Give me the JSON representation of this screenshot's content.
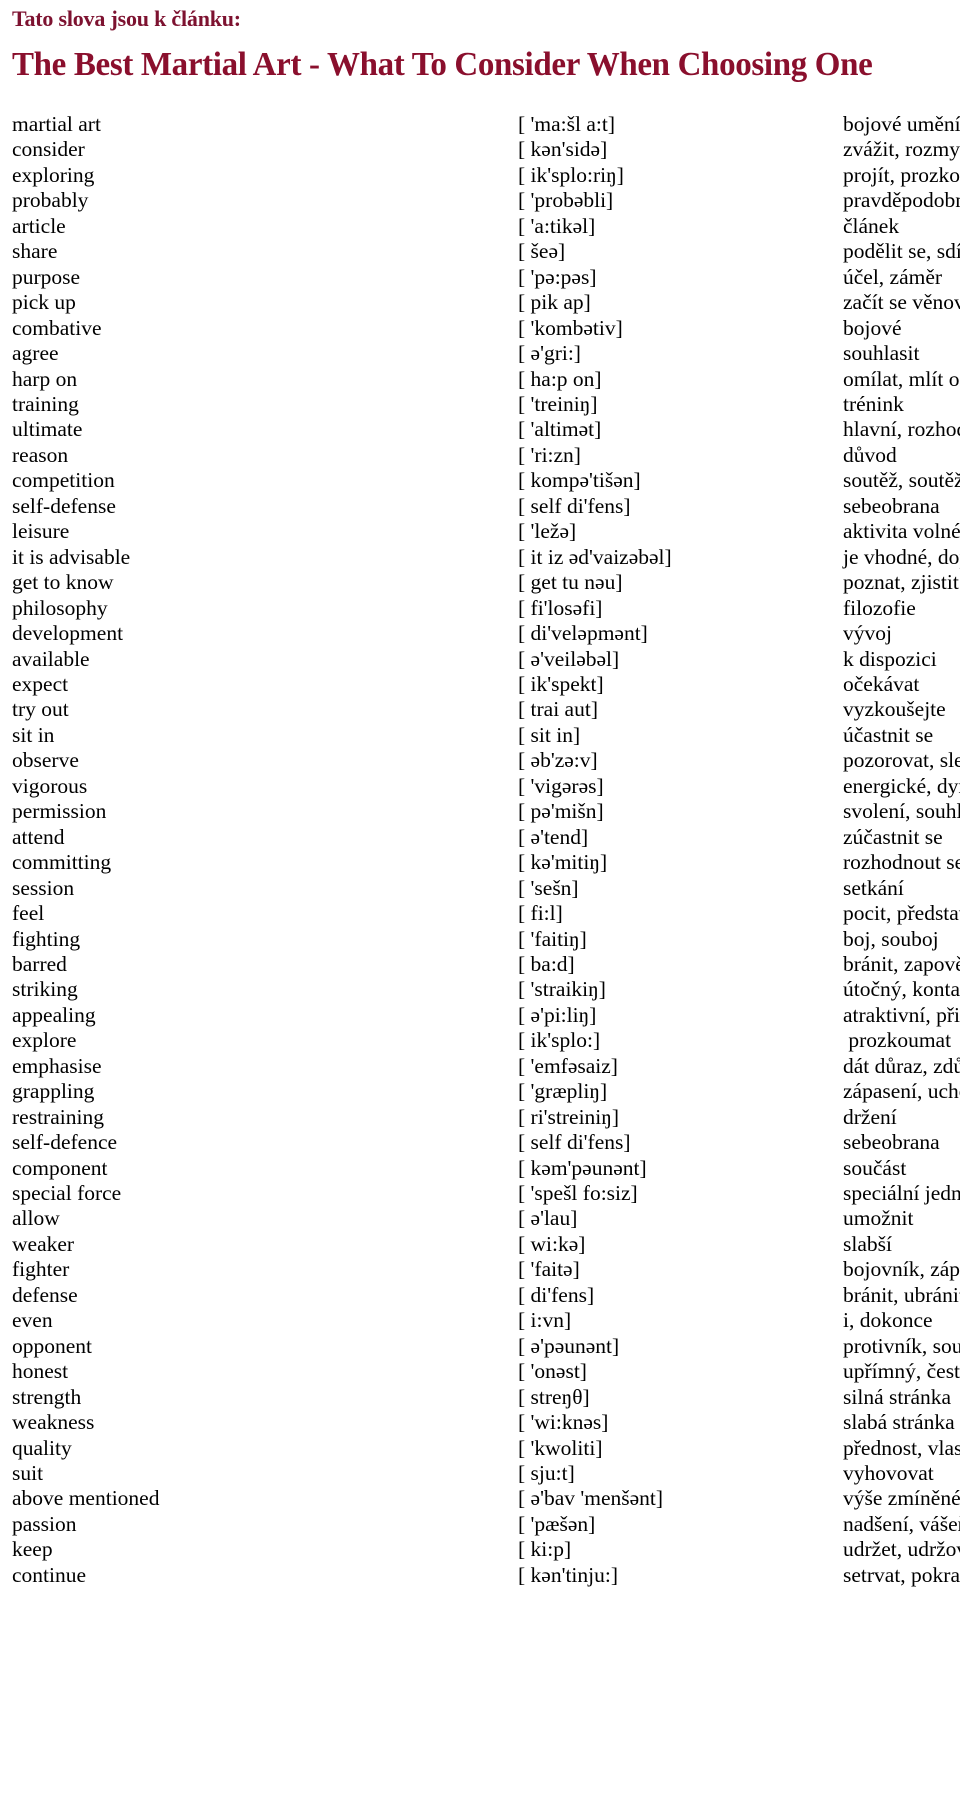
{
  "header": {
    "kicker": "Tato slova jsou k článku:",
    "title": "The Best Martial Art - What To Consider When Choosing One",
    "kicker_color": "#7d1230",
    "title_color": "#8a0f2d"
  },
  "vocabulary": {
    "rows": [
      {
        "term": "martial art",
        "phonetic": "[ 'ma:šl a:t]",
        "translation": "bojové umění"
      },
      {
        "term": "consider",
        "phonetic": "[ kən'sidə]",
        "translation": "zvážit, rozmyslet"
      },
      {
        "term": "exploring",
        "phonetic": "[ ik'splo:riŋ]",
        "translation": "projít, prozkoumat"
      },
      {
        "term": "probably",
        "phonetic": "[ 'probəbli]",
        "translation": "pravděpodobně"
      },
      {
        "term": "article",
        "phonetic": "[ 'a:tikəl]",
        "translation": "článek"
      },
      {
        "term": "share",
        "phonetic": "[ šeə]",
        "translation": "podělit se, sdílet"
      },
      {
        "term": "purpose",
        "phonetic": "[ 'pə:pəs]",
        "translation": "účel, záměr"
      },
      {
        "term": "pick up",
        "phonetic": "[ pik ap]",
        "translation": "začít se věnovat"
      },
      {
        "term": "combative",
        "phonetic": "[ 'kombətiv]",
        "translation": "bojové"
      },
      {
        "term": "agree",
        "phonetic": "[ ə'gri:]",
        "translation": "souhlasit"
      },
      {
        "term": "harp on",
        "phonetic": "[ ha:p on]",
        "translation": "omílat, mlít o čem"
      },
      {
        "term": "training",
        "phonetic": "[ 'treiniŋ]",
        "translation": "trénink"
      },
      {
        "term": "ultimate",
        "phonetic": "[ 'altimət]",
        "translation": "hlavní, rozhodující"
      },
      {
        "term": "reason",
        "phonetic": "[ 'ri:zn]",
        "translation": "důvod"
      },
      {
        "term": "competition",
        "phonetic": "[ kompə'tišən]",
        "translation": "soutěž, soutěžení"
      },
      {
        "term": "self-defense",
        "phonetic": "[ self di'fens]",
        "translation": "sebeobrana"
      },
      {
        "term": "leisure",
        "phonetic": "[ 'ležə]",
        "translation": "aktivita volném čase"
      },
      {
        "term": "it is advisable",
        "phonetic": "[ it iz əd'vaizəbəl]",
        "translation": "je vhodné, doporučuje se"
      },
      {
        "term": "get to know",
        "phonetic": "[ get tu nəu]",
        "translation": "poznat, zjistit"
      },
      {
        "term": "philosophy",
        "phonetic": "[ fi'losəfi]",
        "translation": "filozofie"
      },
      {
        "term": "development",
        "phonetic": "[ di'veləpmənt]",
        "translation": "vývoj"
      },
      {
        "term": "available",
        "phonetic": "[ ə'veiləbəl]",
        "translation": "k dispozici"
      },
      {
        "term": "expect",
        "phonetic": "[ ik'spekt]",
        "translation": "očekávat"
      },
      {
        "term": "try out",
        "phonetic": "[ trai aut]",
        "translation": "vyzkoušejte"
      },
      {
        "term": "sit in",
        "phonetic": "[ sit in]",
        "translation": "účastnit se"
      },
      {
        "term": "observe",
        "phonetic": "[ əb'zə:v]",
        "translation": "pozorovat, sledovat"
      },
      {
        "term": "vigorous",
        "phonetic": "[ 'vigərəs]",
        "translation": "energické, dynamické"
      },
      {
        "term": "permission",
        "phonetic": "[ pə'mišn]",
        "translation": "svolení, souhlas"
      },
      {
        "term": "attend",
        "phonetic": "[ ə'tend]",
        "translation": "zúčastnit se"
      },
      {
        "term": "committing",
        "phonetic": "[ kə'mitiŋ]",
        "translation": "rozhodnout se"
      },
      {
        "term": "session",
        "phonetic": "[ 'sešn]",
        "translation": "setkání"
      },
      {
        "term": "feel",
        "phonetic": "[ fi:l]",
        "translation": "pocit, představa"
      },
      {
        "term": "fighting",
        "phonetic": "[ 'faitiŋ]",
        "translation": "boj, souboj"
      },
      {
        "term": "barred",
        "phonetic": "[ ba:d]",
        "translation": "bránit, zapovědět"
      },
      {
        "term": "striking",
        "phonetic": "[ 'straikiŋ]",
        "translation": "útočný, kontaktní"
      },
      {
        "term": "appealing",
        "phonetic": "[ ə'pi:liŋ]",
        "translation": "atraktivní, přitažlivý"
      },
      {
        "term": "explore",
        "phonetic": "[ ik'splo:]",
        "translation": " prozkoumat"
      },
      {
        "term": "emphasise",
        "phonetic": "[ 'emfəsaiz]",
        "translation": "dát důraz, zdůraznit"
      },
      {
        "term": "grappling",
        "phonetic": "[ 'græpliŋ]",
        "translation": "zápasení, uchopení"
      },
      {
        "term": "restraining",
        "phonetic": "[ ri'streiniŋ]",
        "translation": "držení"
      },
      {
        "term": "self-defence",
        "phonetic": "[ self di'fens]",
        "translation": "sebeobrana"
      },
      {
        "term": "component",
        "phonetic": "[ kəm'pəunənt]",
        "translation": "součást"
      },
      {
        "term": "special force",
        "phonetic": "[ 'spešl fo:siz]",
        "translation": "speciální jednotka"
      },
      {
        "term": "allow",
        "phonetic": "[ ə'lau]",
        "translation": "umožnit"
      },
      {
        "term": "weaker",
        "phonetic": "[ wi:kə]",
        "translation": "slabší"
      },
      {
        "term": "fighter",
        "phonetic": "[ 'faitə]",
        "translation": "bojovník, zápasník"
      },
      {
        "term": "defense",
        "phonetic": "[ di'fens]",
        "translation": "bránit, ubránit"
      },
      {
        "term": "even",
        "phonetic": "[ i:vn]",
        "translation": "i, dokonce"
      },
      {
        "term": "opponent",
        "phonetic": "[ ə'pəunənt]",
        "translation": "protivník, soupeř"
      },
      {
        "term": "honest",
        "phonetic": "[ 'onəst]",
        "translation": "upřímný, čestný"
      },
      {
        "term": "strength",
        "phonetic": "[ streŋθ]",
        "translation": "silná stránka"
      },
      {
        "term": "weakness",
        "phonetic": "[ 'wi:knəs]",
        "translation": "slabá stránka"
      },
      {
        "term": "quality",
        "phonetic": "[ 'kwoliti]",
        "translation": "přednost, vlastnost"
      },
      {
        "term": "suit",
        "phonetic": "[ sju:t]",
        "translation": "vyhovovat"
      },
      {
        "term": "above mentioned",
        "phonetic": "[ ə'bav 'menšənt]",
        "translation": "výše zmíněné"
      },
      {
        "term": "passion",
        "phonetic": "[ 'pæšən]",
        "translation": "nadšení, vášeň"
      },
      {
        "term": "keep",
        "phonetic": "[ ki:p]",
        "translation": "udržet, udržovat"
      },
      {
        "term": "continue",
        "phonetic": "[ kən'tinju:]",
        "translation": "setrvat, pokračovat"
      }
    ]
  }
}
